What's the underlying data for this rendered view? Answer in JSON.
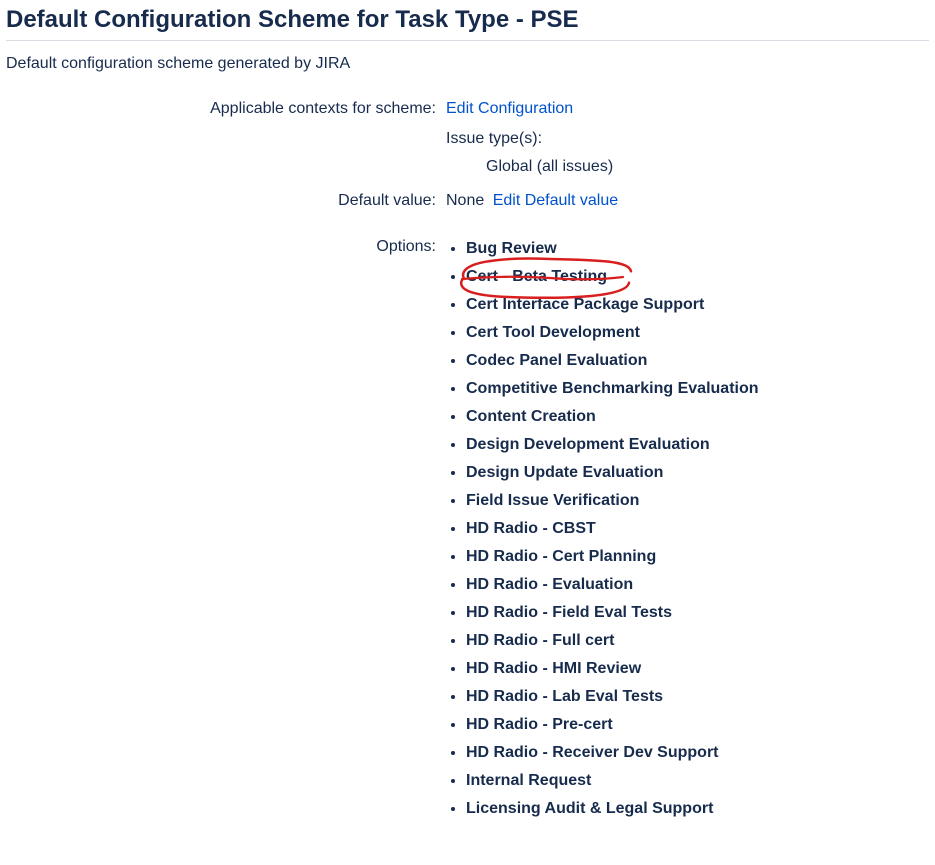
{
  "title": "Default Configuration Scheme for Task Type - PSE",
  "subtitle": "Default configuration scheme generated by JIRA",
  "labels": {
    "contexts": "Applicable contexts for scheme:",
    "default_value": "Default value:",
    "options": "Options:",
    "issue_types": "Issue type(s):"
  },
  "links": {
    "edit_config": "Edit Configuration",
    "edit_default": "Edit Default value"
  },
  "issue_types_value": "Global (all issues)",
  "default_value_text": "None",
  "options": [
    "Bug Review",
    "Cert - Beta Testing",
    "Cert Interface Package Support",
    "Cert Tool Development",
    "Codec Panel Evaluation",
    "Competitive Benchmarking Evaluation",
    "Content Creation",
    "Design Development Evaluation",
    "Design Update Evaluation",
    "Field Issue Verification",
    "HD Radio - CBST",
    "HD Radio - Cert Planning",
    "HD Radio - Evaluation",
    "HD Radio - Field Eval Tests",
    "HD Radio - Full cert",
    "HD Radio - HMI Review",
    "HD Radio - Lab Eval Tests",
    "HD Radio - Pre-cert",
    "HD Radio - Receiver Dev Support",
    "Internal Request",
    "Licensing Audit & Legal Support"
  ],
  "annotation": {
    "target_option_index": 1,
    "color": "#d81e1e"
  }
}
